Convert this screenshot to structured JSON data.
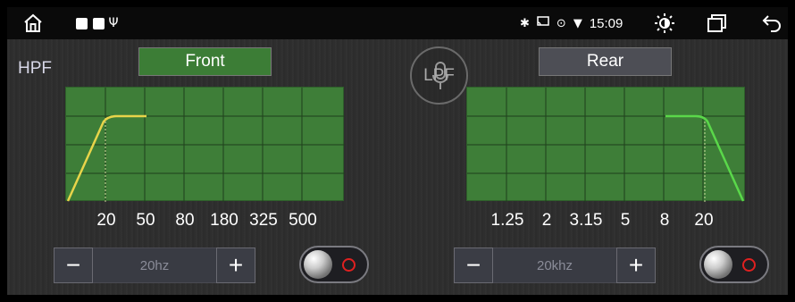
{
  "statusbar": {
    "home_icon": "home-icon",
    "clock": "15:09",
    "usb_glyph": "Ψ",
    "bt_glyph": "✱",
    "location_glyph": "⊙",
    "wifi_glyph": "▼"
  },
  "hpf_label": "HPF",
  "lpf_label": "LPF",
  "front": {
    "channel_label": "Front",
    "frequency_ticks": [
      "20",
      "50",
      "80",
      "180",
      "325",
      "500"
    ],
    "value": "20hz",
    "curve_color": "#e8d44a"
  },
  "rear": {
    "channel_label": "Rear",
    "frequency_ticks": [
      "1.25",
      "2",
      "3.15",
      "5",
      "8",
      "20"
    ],
    "value": "20khz",
    "curve_color": "#5ad84a"
  },
  "stepper": {
    "minus": "−",
    "plus": "+"
  },
  "colors": {
    "graph_bg": "#3e7e38",
    "grid": "#1f3f1c",
    "front_active": "#3c7d36",
    "toggle_ring": "#e02020"
  }
}
